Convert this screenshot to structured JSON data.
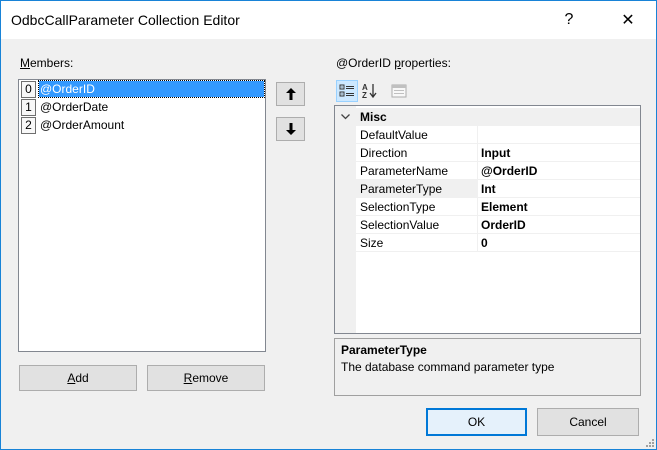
{
  "window": {
    "title": "OdbcCallParameter Collection Editor",
    "help_glyph": "?",
    "close_glyph": "✕"
  },
  "members": {
    "label_mnemonic": "M",
    "label_rest": "embers:",
    "items": [
      {
        "index": "0",
        "name": "@OrderID",
        "selected": true
      },
      {
        "index": "1",
        "name": "@OrderDate",
        "selected": false
      },
      {
        "index": "2",
        "name": "@OrderAmount",
        "selected": false
      }
    ]
  },
  "move_buttons": {
    "up_glyph": "🡑",
    "down_glyph": "🡓"
  },
  "properties": {
    "label_prefix": "@OrderID ",
    "label_mnemonic": "p",
    "label_rest": "roperties:",
    "category": "Misc",
    "rows": [
      {
        "name": "DefaultValue",
        "value": ""
      },
      {
        "name": "Direction",
        "value": "Input"
      },
      {
        "name": "ParameterName",
        "value": "@OrderID"
      },
      {
        "name": "ParameterType",
        "value": "Int"
      },
      {
        "name": "SelectionType",
        "value": "Element"
      },
      {
        "name": "SelectionValue",
        "value": "OrderID"
      },
      {
        "name": "Size",
        "value": "0"
      }
    ]
  },
  "help": {
    "title": "ParameterType",
    "description": "The database command parameter type"
  },
  "buttons": {
    "add_mnemonic": "A",
    "add_rest": "dd",
    "remove_mnemonic": "R",
    "remove_rest": "emove",
    "ok": "OK",
    "cancel": "Cancel"
  },
  "colors": {
    "selection": "#3399ff",
    "window_border": "#1883d7",
    "default_button_border": "#0078d7"
  },
  "icons": {
    "categorized": "categorized-view-icon",
    "alphabetical": "alphabetical-sort-icon",
    "property_pages": "property-pages-icon"
  }
}
